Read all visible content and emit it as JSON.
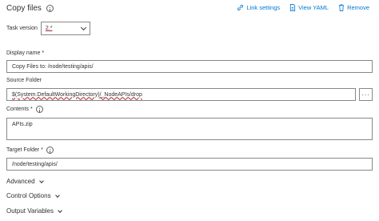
{
  "header": {
    "title": "Copy files",
    "actions": {
      "link_settings": "Link settings",
      "view_yaml": "View YAML",
      "remove": "Remove"
    }
  },
  "task_version": {
    "label": "Task version",
    "value": "2.*"
  },
  "display_name": {
    "label": "Display name *",
    "value": "Copy Files to: /node/testing/apis/"
  },
  "source_folder": {
    "label": "Source Folder",
    "value": "$(System.DefaultWorkingDirectory)/_NodeAPIs/drop",
    "browse": "···"
  },
  "contents": {
    "label": "Contents *",
    "value": "APIs.zip"
  },
  "target_folder": {
    "label": "Target Folder *",
    "value": "/node/testing/apis/"
  },
  "sections": {
    "advanced": "Advanced",
    "control_options": "Control Options",
    "output_variables": "Output Variables"
  },
  "colors": {
    "link": "#0078d4",
    "border": "#8a8886",
    "error_underline": "#a4262c"
  }
}
